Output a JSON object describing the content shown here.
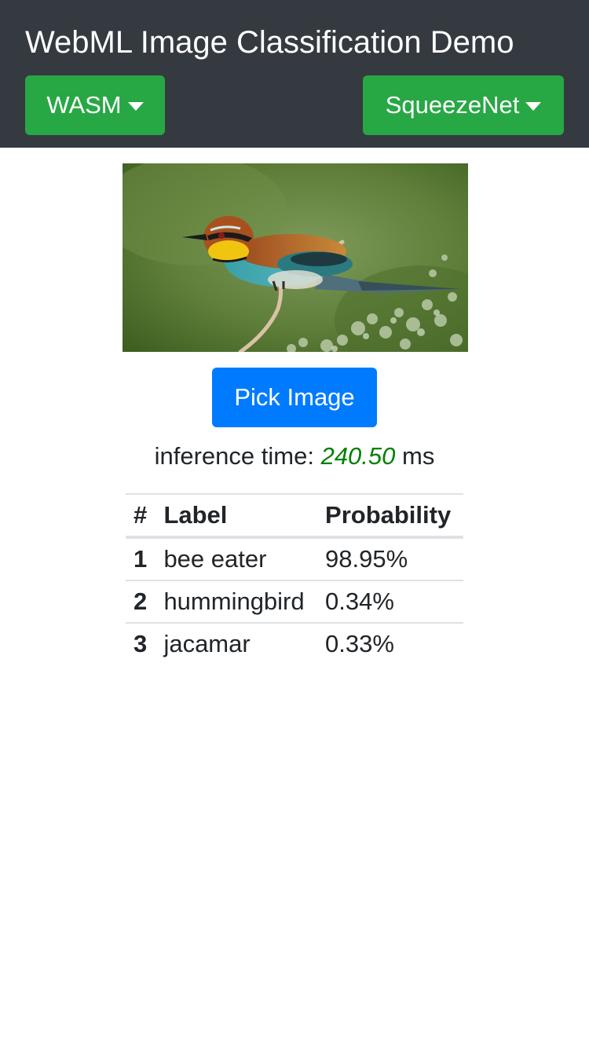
{
  "header": {
    "title": "WebML Image Classification Demo",
    "backend_label": "WASM",
    "model_label": "SqueezeNet",
    "bg_color": "#343a40",
    "dropdown_color": "#28a745"
  },
  "main": {
    "image": {
      "subject": "bird"
    },
    "pick_button_label": "Pick Image",
    "pick_button_color": "#007bff",
    "inference": {
      "prefix": "inference time:",
      "value": "240.50",
      "unit": "ms",
      "value_color": "#008000"
    },
    "results": {
      "headers": [
        "#",
        "Label",
        "Probability"
      ],
      "rows": [
        {
          "rank": "1",
          "label": "bee eater",
          "probability": "98.95%"
        },
        {
          "rank": "2",
          "label": "hummingbird",
          "probability": "0.34%"
        },
        {
          "rank": "3",
          "label": "jacamar",
          "probability": "0.33%"
        }
      ]
    }
  }
}
